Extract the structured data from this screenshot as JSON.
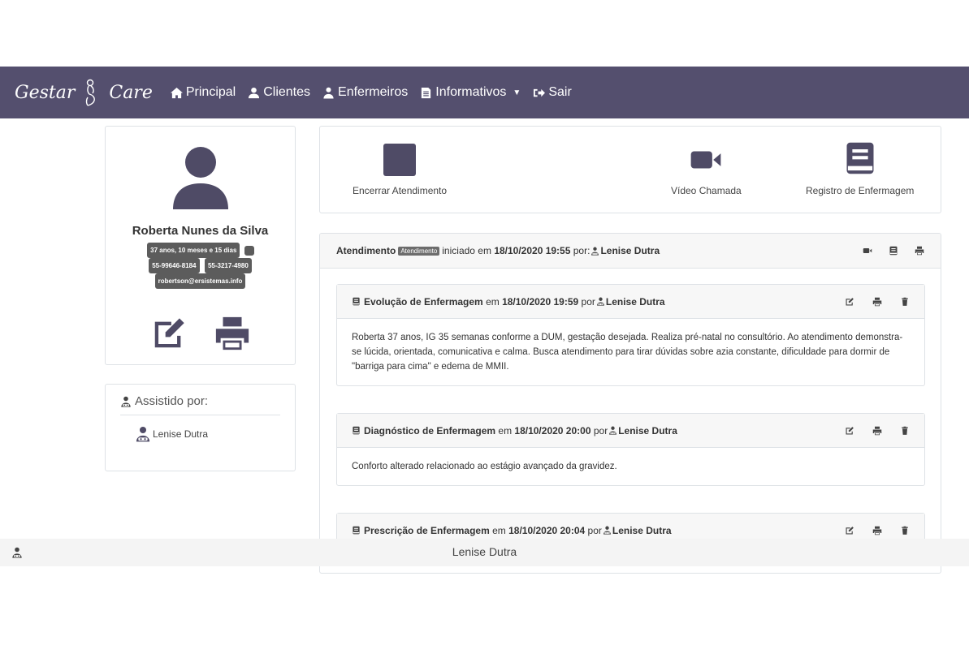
{
  "brand": {
    "left": "Gestar",
    "right": "Care"
  },
  "nav": {
    "principal": "Principal",
    "clientes": "Clientes",
    "enfermeiros": "Enfermeiros",
    "informativos": "Informativos",
    "sair": "Sair"
  },
  "profile": {
    "name": "Roberta Nunes da Silva",
    "age": "37 anos, 10 meses e 15 dias",
    "phone1": "55-99646-8184",
    "phone2": "55-3217-4980",
    "email": "robertson@ersistemas.info"
  },
  "assisted": {
    "title": "Assistido por:",
    "nurse": "Lenise Dutra"
  },
  "actions": {
    "end": "Encerrar Atendimento",
    "video": "Vídeo Chamada",
    "record": "Registro de Enfermagem"
  },
  "attendance": {
    "label": "Atendimento",
    "status": "Atendimento",
    "started_text": "iniciado em",
    "datetime": "18/10/2020 19:55",
    "by": "por:",
    "nurse": "Lenise Dutra"
  },
  "entries": [
    {
      "title": "Evolução de Enfermagem",
      "on": "em",
      "datetime": "18/10/2020 19:59",
      "by": "por",
      "nurse": "Lenise Dutra",
      "text": "Roberta 37 anos, IG 35 semanas conforme a DUM, gestação desejada. Realiza pré-natal no consultório. Ao atendimento demonstra-se lúcida, orientada, comunicativa e calma. Busca atendimento para tirar dúvidas sobre azia constante, dificuldade para dormir de \"barriga para cima\" e edema de MMII."
    },
    {
      "title": "Diagnóstico de Enfermagem",
      "on": "em",
      "datetime": "18/10/2020 20:00",
      "by": "por",
      "nurse": "Lenise Dutra",
      "text": "Conforto alterado relacionado ao estágio avançado da gravidez."
    },
    {
      "title": "Prescrição de Enfermagem",
      "on": "em",
      "datetime": "18/10/2020 20:04",
      "by": "por",
      "nurse": "Lenise Dutra",
      "text": ""
    }
  ],
  "footer": {
    "user": "Lenise Dutra"
  }
}
